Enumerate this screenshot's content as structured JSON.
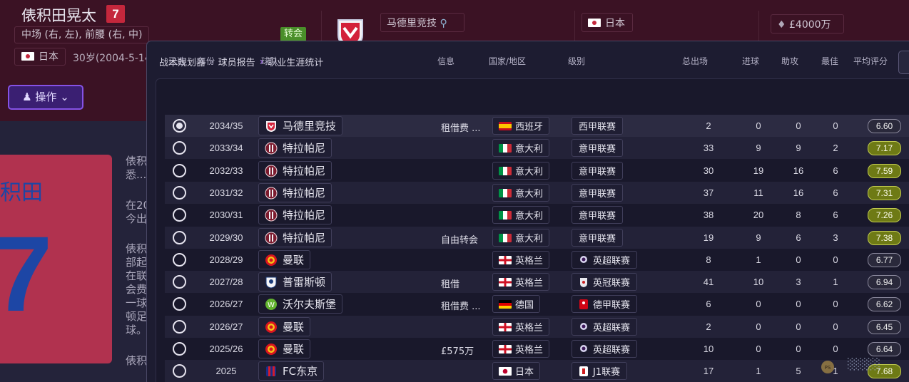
{
  "player": {
    "name": "俵积田晃太",
    "shirt_number": "7",
    "positions": "中场 (右, 左), 前腰 (右, 中)",
    "nationality": "日本",
    "age_dob": "30岁(2004-5-14",
    "action_label": "操作",
    "status_badge": "转会",
    "club": "马德里竞技",
    "club_nation": "日本",
    "value": "£4000万",
    "card_name": "积田",
    "card_number": "7",
    "bio_lines": [
      "俵积",
      "悉...",
      "在20",
      "今出",
      "俵积",
      "部起",
      "在联",
      "会费",
      "一球",
      "顿足",
      "球。",
      "俵积"
    ]
  },
  "modal": {
    "breadcrumb": [
      "战术规划器",
      "球员报告",
      "职业生涯统计"
    ]
  },
  "table": {
    "headers": {
      "selected": "已选",
      "season": "年份",
      "team": "球队",
      "info": "信息",
      "nation": "国家/地区",
      "division": "级别",
      "apps": "总出场",
      "goals": "进球",
      "assists": "助攻",
      "potm": "最佳",
      "avg_rating": "平均评分"
    },
    "rows": [
      {
        "selected": true,
        "season": "2034/35",
        "team": "马德里竞技",
        "crest": "atletico-madrid-crest",
        "info": "租借费 ...",
        "nation": "西班牙",
        "flag": "spain-flag",
        "division": "西甲联赛",
        "apps": "2",
        "goals": "0",
        "assists": "0",
        "potm": "0",
        "rating": "6.60",
        "rating_good": false
      },
      {
        "selected": false,
        "season": "2033/34",
        "team": "特拉帕尼",
        "crest": "trapani-crest",
        "info": "",
        "nation": "意大利",
        "flag": "italy-flag",
        "division": "意甲联赛",
        "apps": "33",
        "goals": "9",
        "assists": "9",
        "potm": "2",
        "rating": "7.17",
        "rating_good": true
      },
      {
        "selected": false,
        "season": "2032/33",
        "team": "特拉帕尼",
        "crest": "trapani-crest",
        "info": "",
        "nation": "意大利",
        "flag": "italy-flag",
        "division": "意甲联赛",
        "apps": "30",
        "goals": "19",
        "assists": "16",
        "potm": "6",
        "rating": "7.59",
        "rating_good": true
      },
      {
        "selected": false,
        "season": "2031/32",
        "team": "特拉帕尼",
        "crest": "trapani-crest",
        "info": "",
        "nation": "意大利",
        "flag": "italy-flag",
        "division": "意甲联赛",
        "apps": "37",
        "goals": "11",
        "assists": "16",
        "potm": "6",
        "rating": "7.31",
        "rating_good": true
      },
      {
        "selected": false,
        "season": "2030/31",
        "team": "特拉帕尼",
        "crest": "trapani-crest",
        "info": "",
        "nation": "意大利",
        "flag": "italy-flag",
        "division": "意甲联赛",
        "apps": "38",
        "goals": "20",
        "assists": "8",
        "potm": "6",
        "rating": "7.26",
        "rating_good": true
      },
      {
        "selected": false,
        "season": "2029/30",
        "team": "特拉帕尼",
        "crest": "trapani-crest",
        "info": "自由转会",
        "nation": "意大利",
        "flag": "italy-flag",
        "division": "意甲联赛",
        "apps": "19",
        "goals": "9",
        "assists": "6",
        "potm": "3",
        "rating": "7.38",
        "rating_good": true
      },
      {
        "selected": false,
        "season": "2028/29",
        "team": "曼联",
        "crest": "man-utd-crest",
        "info": "",
        "nation": "英格兰",
        "flag": "england-flag",
        "division": "英超联赛",
        "apps": "8",
        "goals": "1",
        "assists": "0",
        "potm": "0",
        "rating": "6.77",
        "rating_good": false
      },
      {
        "selected": false,
        "season": "2027/28",
        "team": "普雷斯顿",
        "crest": "preston-crest",
        "info": "租借",
        "nation": "英格兰",
        "flag": "england-flag",
        "division": "英冠联赛",
        "apps": "41",
        "goals": "10",
        "assists": "3",
        "potm": "1",
        "rating": "6.94",
        "rating_good": false
      },
      {
        "selected": false,
        "season": "2026/27",
        "team": "沃尔夫斯堡",
        "crest": "wolfsburg-crest",
        "info": "租借费 ...",
        "nation": "德国",
        "flag": "germany-flag",
        "division": "德甲联赛",
        "apps": "6",
        "goals": "0",
        "assists": "0",
        "potm": "0",
        "rating": "6.62",
        "rating_good": false
      },
      {
        "selected": false,
        "season": "2026/27",
        "team": "曼联",
        "crest": "man-utd-crest",
        "info": "",
        "nation": "英格兰",
        "flag": "england-flag",
        "division": "英超联赛",
        "apps": "2",
        "goals": "0",
        "assists": "0",
        "potm": "0",
        "rating": "6.45",
        "rating_good": false
      },
      {
        "selected": false,
        "season": "2025/26",
        "team": "曼联",
        "crest": "man-utd-crest",
        "info": "£575万",
        "nation": "英格兰",
        "flag": "england-flag",
        "division": "英超联赛",
        "apps": "10",
        "goals": "0",
        "assists": "0",
        "potm": "0",
        "rating": "6.64",
        "rating_good": false
      },
      {
        "selected": false,
        "season": "2025",
        "team": "FC东京",
        "crest": "fc-tokyo-crest",
        "info": "",
        "nation": "日本",
        "flag": "japan-flag",
        "division": "J1联赛",
        "apps": "17",
        "goals": "1",
        "assists": "5",
        "potm": "1",
        "rating": "7.68",
        "rating_good": true
      }
    ]
  },
  "colors": {
    "header_bg": "#3b1224",
    "accent_purple": "#8552e6",
    "good_rating": "#6e7a15",
    "card_red": "#b1324f"
  }
}
